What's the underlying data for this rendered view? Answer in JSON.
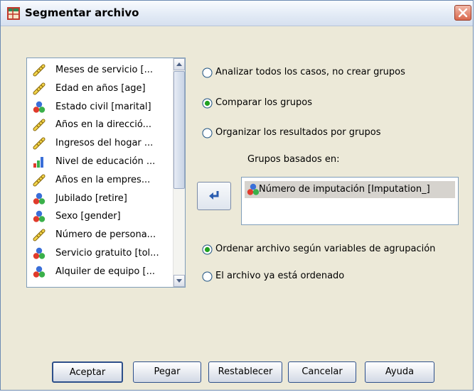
{
  "window": {
    "title": "Segmentar archivo",
    "close_symbol": "✕"
  },
  "variables": [
    {
      "label": "Meses de servicio [...",
      "icon": "scale-icon"
    },
    {
      "label": "Edad en años [age]",
      "icon": "scale-icon"
    },
    {
      "label": "Estado civil [marital]",
      "icon": "nominal-icon"
    },
    {
      "label": "Años en la direcció...",
      "icon": "scale-icon"
    },
    {
      "label": "Ingresos del hogar ...",
      "icon": "scale-icon"
    },
    {
      "label": "Nivel de educación ...",
      "icon": "ordinal-icon"
    },
    {
      "label": "Años en la empres...",
      "icon": "scale-icon"
    },
    {
      "label": "Jubilado [retire]",
      "icon": "nominal-icon"
    },
    {
      "label": "Sexo [gender]",
      "icon": "nominal-icon"
    },
    {
      "label": "Número de persona...",
      "icon": "scale-icon"
    },
    {
      "label": "Servicio gratuito [tol...",
      "icon": "nominal-icon"
    },
    {
      "label": "Alquiler de equipo [...",
      "icon": "nominal-icon"
    }
  ],
  "options": {
    "analyze_all": {
      "label": "Analizar todos los casos, no crear grupos",
      "selected": false
    },
    "compare": {
      "label": "Comparar los grupos",
      "selected": true
    },
    "organize": {
      "label": "Organizar los resultados por grupos",
      "selected": false
    }
  },
  "groups": {
    "label": "Grupos basados en:",
    "items": [
      "Número de imputación [Imputation_]"
    ]
  },
  "sort": {
    "sort_by_vars": {
      "label": "Ordenar archivo según variables de agrupación",
      "selected": true
    },
    "already_sorted": {
      "label": "El archivo ya está ordenado",
      "selected": false
    }
  },
  "buttons": {
    "ok": "Aceptar",
    "paste": "Pegar",
    "reset": "Restablecer",
    "cancel": "Cancelar",
    "help": "Ayuda"
  }
}
